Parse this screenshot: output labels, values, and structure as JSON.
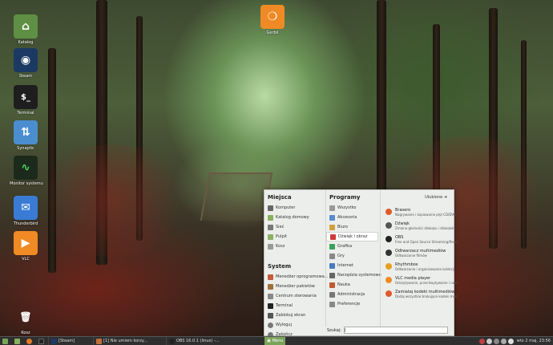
{
  "desktop": {
    "icons": [
      {
        "label": "Katalog",
        "color": "#5f8f45",
        "glyph": "⌂"
      },
      {
        "label": "Steam",
        "color": "#1b3a63",
        "glyph": "◉"
      },
      {
        "label": "Terminal",
        "color": "#1e1e1e",
        "glyph": "$_"
      },
      {
        "label": "Synaptic",
        "color": "#4a8ed0",
        "glyph": "⇅"
      },
      {
        "label": "Monitor systemu",
        "color": "#1c2a1c",
        "glyph": "∿"
      },
      {
        "label": "Thunderbird",
        "color": "#3a7bd5",
        "glyph": "✉"
      },
      {
        "label": "VLC",
        "color": "#f08a24",
        "glyph": "▶"
      },
      {
        "label": "Kosz",
        "color": "#777777",
        "glyph": "🗑"
      },
      {
        "label": "Gerbil",
        "color": "#f08a24",
        "glyph": "❍"
      }
    ]
  },
  "menu": {
    "places": {
      "title": "Miejsca",
      "items": [
        "Komputer",
        "Katalog domowy",
        "Sieć",
        "Pulpit",
        "Kosz"
      ]
    },
    "system": {
      "title": "System",
      "items": [
        "Menedżer oprogramowa...",
        "Menedżer pakietów",
        "Centrum sterowania",
        "Terminal",
        "Zablokuj ekran",
        "Wyloguj",
        "Zakończ"
      ]
    },
    "programs": {
      "title": "Programy",
      "favorites": "Ulubione",
      "categories": [
        "Wszystko",
        "Akcesoria",
        "Biuro",
        "Dźwięk i obraz",
        "Grafika",
        "Gry",
        "Internet",
        "Narzędzia systemowe",
        "Nauka",
        "Administracja",
        "Preferencje"
      ],
      "selected": "Dźwięk i obraz"
    },
    "apps": [
      {
        "name": "Brasero",
        "desc": "Nagrywanie i kopiowanie płyt CD/DVD",
        "color": "#e05a2b"
      },
      {
        "name": "Dźwięk",
        "desc": "Zmiana głośności dźwięku i dźwięków ...",
        "color": "#555555"
      },
      {
        "name": "OBS",
        "desc": "Free and Open Source Streaming/Reco...",
        "color": "#222222"
      },
      {
        "name": "Odtwarzacz multimediów",
        "desc": "Odtwarzanie filmów",
        "color": "#333333"
      },
      {
        "name": "Rhythmbox",
        "desc": "Odtwarzanie i organizowanie kolekcji ...",
        "color": "#e8a020"
      },
      {
        "name": "VLC media player",
        "desc": "Odczytywanie, przechwytywanie i nad...",
        "color": "#f08a24"
      },
      {
        "name": "Zamiataj kodeki multimediów",
        "desc": "Dodaj wszystkie brakujące kodeki mult...",
        "color": "#e05a2b"
      }
    ],
    "search": {
      "label": "Szukaj:",
      "value": "|"
    }
  },
  "taskbar": {
    "menu_label": "Menu",
    "tasks": [
      "[Steam]",
      "[1] Nie umiem korzy...",
      "OBS 16.0.1 (linux) -..."
    ],
    "clock": "wto 2 maj, 23:56"
  }
}
